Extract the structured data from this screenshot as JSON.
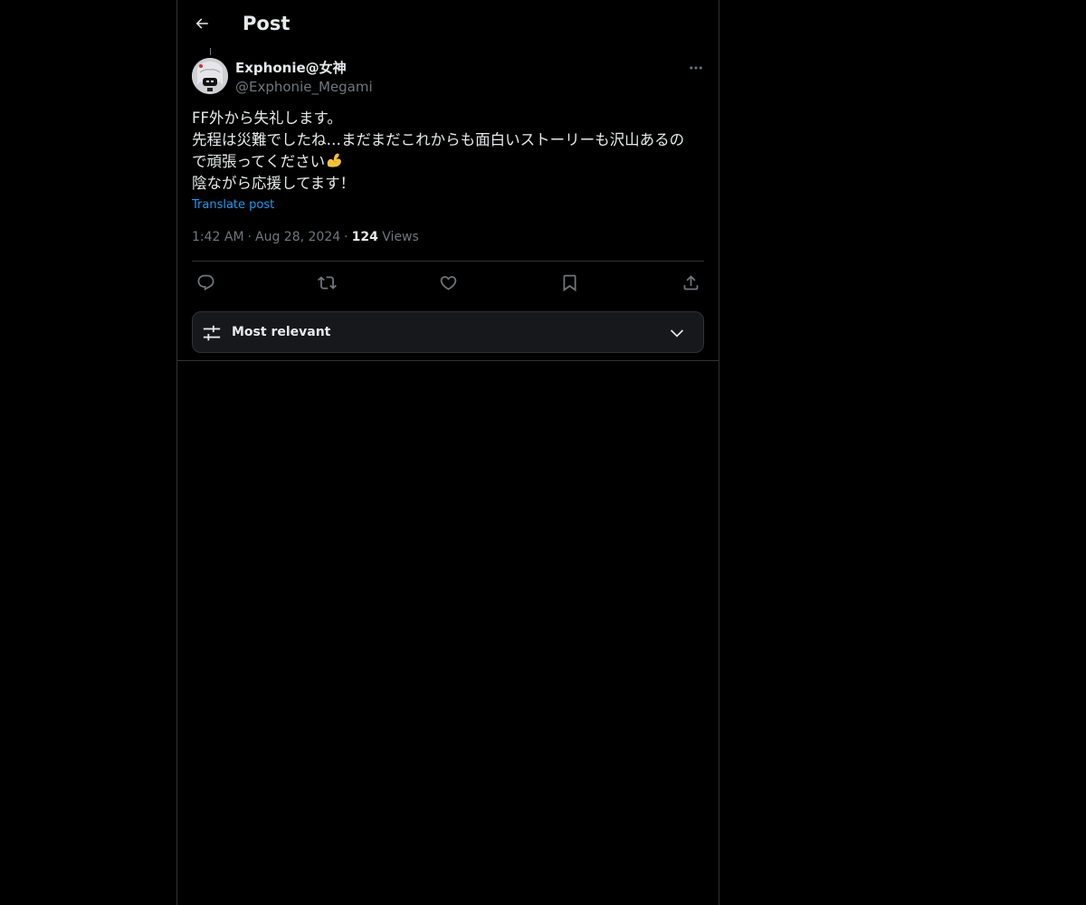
{
  "header": {
    "title": "Post",
    "back_icon": "arrow-left-icon"
  },
  "post": {
    "author": {
      "display_name": "Exphonie@女神",
      "handle": "@Exphonie_Megami"
    },
    "text_lines": [
      "FF外から失礼します。",
      "先程は災難でしたね…まだまだこれからも面白いストーリーも沢山あるの",
      "で頑張ってください",
      "陰ながら応援してます！"
    ],
    "emoji": "flexed-biceps-icon",
    "translate_label": "Translate post",
    "time": "1:42 AM",
    "date": "Aug 28, 2024",
    "separator": "·",
    "views_count": "124",
    "views_label": "Views"
  },
  "actions": [
    {
      "name": "reply",
      "icon": "reply-icon"
    },
    {
      "name": "repost",
      "icon": "repost-icon"
    },
    {
      "name": "like",
      "icon": "heart-icon"
    },
    {
      "name": "bookmark",
      "icon": "bookmark-icon"
    },
    {
      "name": "share",
      "icon": "share-icon"
    }
  ],
  "replies_sort": {
    "selected": "Most relevant",
    "icon": "sliders-icon"
  },
  "colors": {
    "background": "#000000",
    "text_primary": "#e7e9ea",
    "text_secondary": "#71767b",
    "link": "#1d9bf0",
    "border": "#2f3336",
    "sort_box_bg": "#16181c"
  }
}
